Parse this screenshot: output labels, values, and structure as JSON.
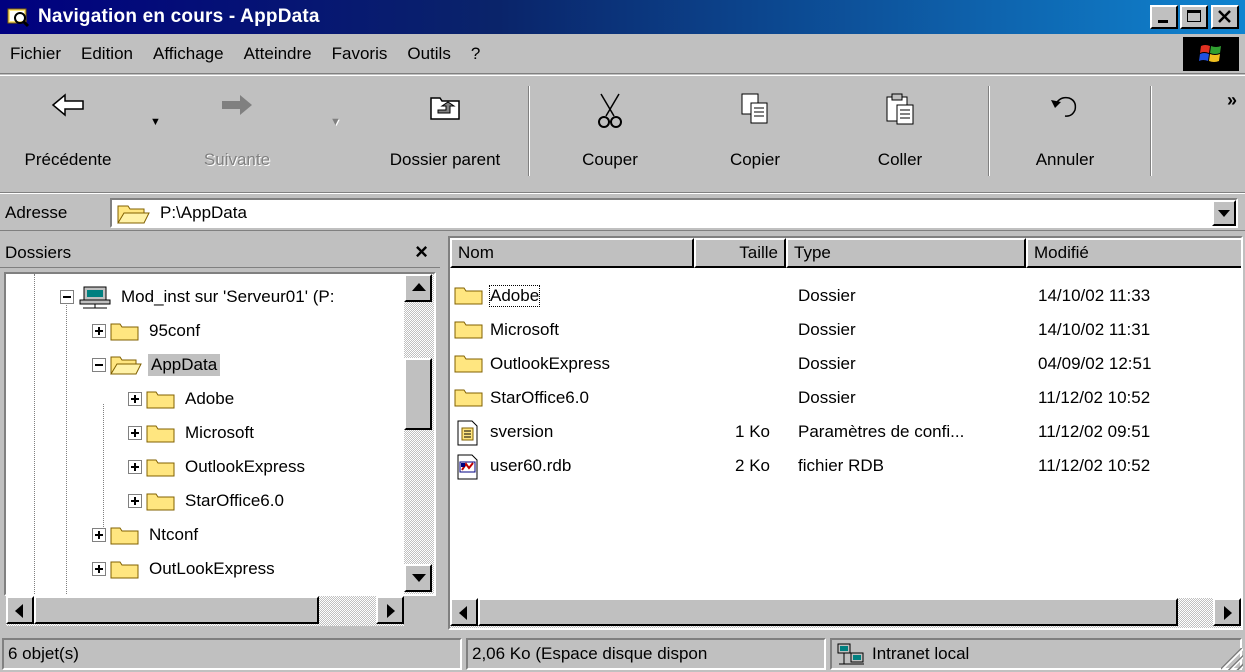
{
  "window": {
    "title": "Navigation en cours - AppData",
    "colors": {
      "titlebar_start": "#000080",
      "titlebar_end": "#1084d0",
      "face": "#c0c0c0",
      "selection": "#c0c0c0"
    }
  },
  "menu": {
    "items": [
      "Fichier",
      "Edition",
      "Affichage",
      "Atteindre",
      "Favoris",
      "Outils",
      "?"
    ]
  },
  "toolbar": {
    "back_label": "Précédente",
    "forward_label": "Suivante",
    "up_label": "Dossier parent",
    "cut_label": "Couper",
    "copy_label": "Copier",
    "paste_label": "Coller",
    "undo_label": "Annuler",
    "more_label": "»"
  },
  "address": {
    "label": "Adresse",
    "value": "P:\\AppData"
  },
  "folders": {
    "title": "Dossiers",
    "close_label": "×",
    "tree": [
      {
        "label": "Mod_inst sur 'Serveur01' (P:",
        "icon": "network-drive-icon",
        "expanded": true
      },
      {
        "label": "95conf",
        "icon": "folder-icon",
        "expanded": false
      },
      {
        "label": "AppData",
        "icon": "folder-open-icon",
        "expanded": true,
        "selected": true
      },
      {
        "label": "Adobe",
        "icon": "folder-icon",
        "expanded": false
      },
      {
        "label": "Microsoft",
        "icon": "folder-icon",
        "expanded": false
      },
      {
        "label": "OutlookExpress",
        "icon": "folder-icon",
        "expanded": false
      },
      {
        "label": "StarOffice6.0",
        "icon": "folder-icon",
        "expanded": false
      },
      {
        "label": "Ntconf",
        "icon": "folder-icon",
        "expanded": false
      },
      {
        "label": "OutLookExpress",
        "icon": "folder-icon",
        "expanded": false
      }
    ]
  },
  "files": {
    "columns": [
      "Nom",
      "Taille",
      "Type",
      "Modifié"
    ],
    "rows": [
      {
        "name": "Adobe",
        "size": "",
        "type": "Dossier",
        "modified": "14/10/02 11:33",
        "icon": "folder-icon"
      },
      {
        "name": "Microsoft",
        "size": "",
        "type": "Dossier",
        "modified": "14/10/02 11:31",
        "icon": "folder-icon"
      },
      {
        "name": "OutlookExpress",
        "size": "",
        "type": "Dossier",
        "modified": "04/09/02 12:51",
        "icon": "folder-icon"
      },
      {
        "name": "StarOffice6.0",
        "size": "",
        "type": "Dossier",
        "modified": "11/12/02 10:52",
        "icon": "folder-icon"
      },
      {
        "name": "sversion",
        "size": "1 Ko",
        "type": "Paramètres de confi...",
        "modified": "11/12/02 09:51",
        "icon": "config-file-icon"
      },
      {
        "name": "user60.rdb",
        "size": "2 Ko",
        "type": "fichier RDB",
        "modified": "11/12/02 10:52",
        "icon": "rdb-file-icon"
      }
    ]
  },
  "status": {
    "objects": "6 objet(s)",
    "size": "2,06 Ko (Espace disque dispon",
    "zone": "Intranet local"
  }
}
